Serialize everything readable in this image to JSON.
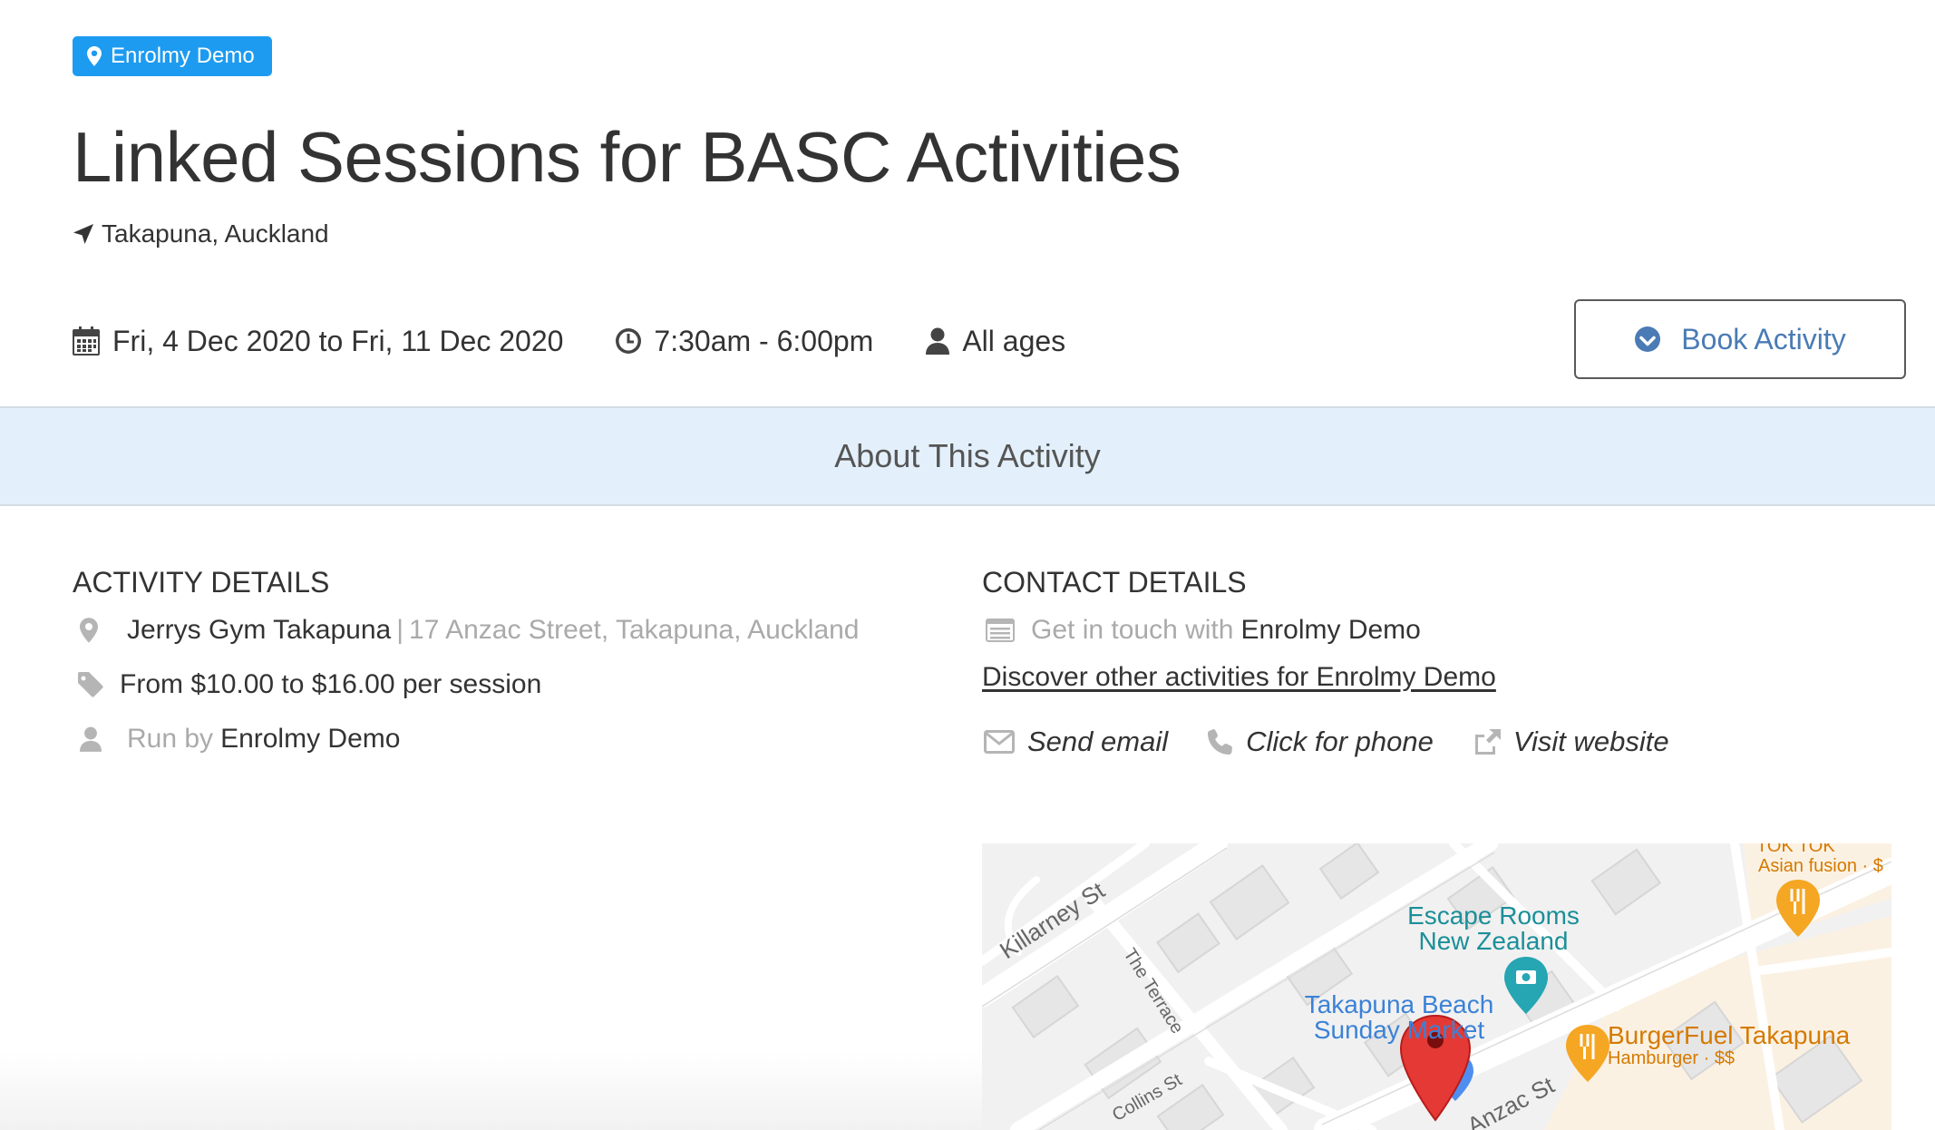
{
  "header": {
    "organization": "Enrolmy Demo",
    "title": "Linked Sessions for BASC Activities",
    "location": "Takapuna, Auckland",
    "date_range": "Fri, 4 Dec 2020 to Fri, 11 Dec 2020",
    "time_range": "7:30am - 6:00pm",
    "ages": "All ages",
    "book_label": "Book Activity",
    "icons": {
      "organization": "map-marker-icon",
      "location": "location-arrow-icon",
      "date": "calendar-icon",
      "time": "clock-icon",
      "ages": "user-icon",
      "book": "check-circle-icon"
    },
    "colors": {
      "pill": "#1d9bf0",
      "book_text": "#4a7bb5"
    }
  },
  "about": {
    "heading": "About This Activity",
    "background": "#e3f0fb"
  },
  "activity_details": {
    "heading": "ACTIVITY DETAILS",
    "venue_name": "Jerrys Gym Takapuna",
    "separator": "|",
    "venue_address": "17 Anzac Street, Takapuna, Auckland",
    "price": "From $10.00 to $16.00 per session",
    "run_by_prefix": "Run by",
    "run_by_name": "Enrolmy Demo"
  },
  "contact_details": {
    "heading": "CONTACT DETAILS",
    "get_in_touch_prefix": "Get in touch with",
    "get_in_touch_name": "Enrolmy Demo",
    "discover_link": "Discover other activities for Enrolmy Demo",
    "actions": [
      {
        "label": "Send email",
        "icon": "envelope-icon"
      },
      {
        "label": "Click for phone",
        "icon": "phone-icon"
      },
      {
        "label": "Visit website",
        "icon": "external-link-icon"
      }
    ]
  },
  "map": {
    "labels": {
      "tok_tok": "TOK TOK",
      "asian_fusion": "Asian fusion · $",
      "escape_line1": "Escape Rooms",
      "escape_line2": "New Zealand",
      "market_line1": "Takapuna Beach",
      "market_line2": "Sunday Market",
      "burgerfuel": "BurgerFuel Takapuna",
      "burgerfuel_sub": "Hamburger · $$",
      "killarney": "Killarney St",
      "terrace": "The Terrace",
      "collins": "Collins St",
      "anzac": "Anzac St"
    },
    "colors": {
      "marker": "#e53935",
      "poi_orange": "#f5a623",
      "poi_teal": "#26a5b3"
    }
  }
}
